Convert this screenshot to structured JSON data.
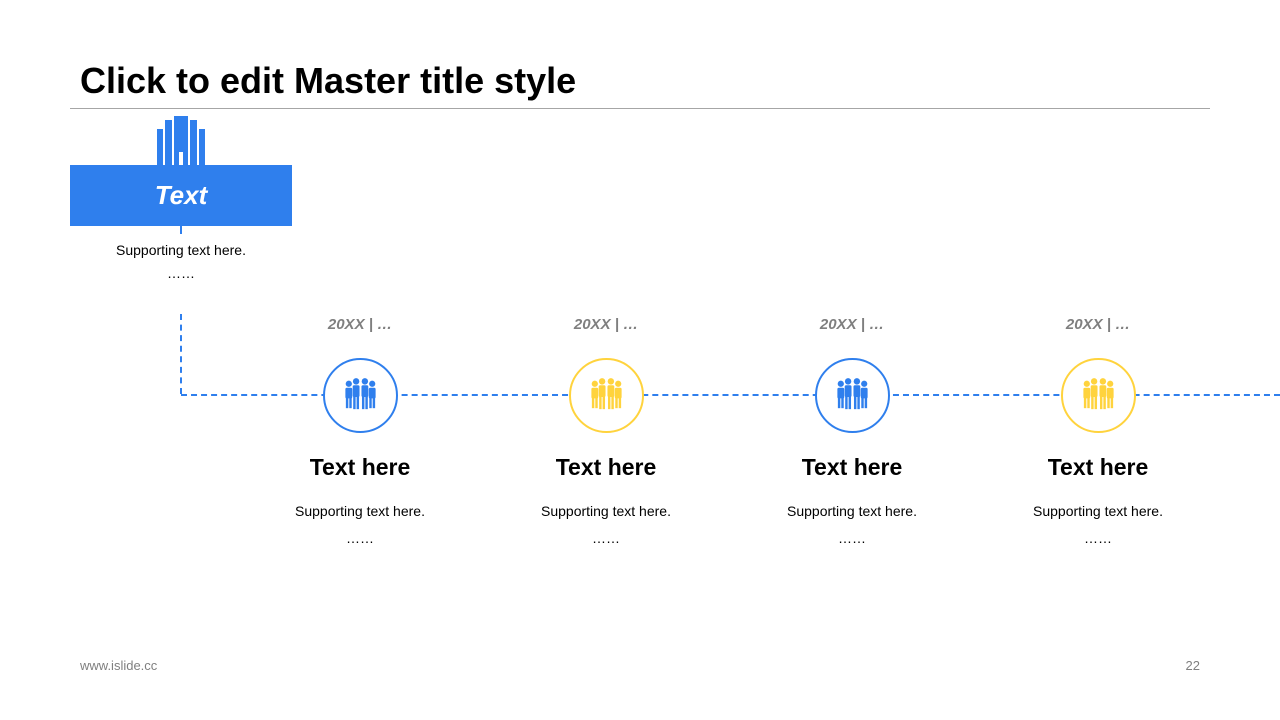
{
  "title": "Click to edit Master title style",
  "intro": {
    "icon": "building-icon",
    "banner_label": "Text",
    "support": "Supporting  text here.",
    "dots": "……"
  },
  "colors": {
    "blue": "#2f7fed",
    "yellow": "#ffd33d",
    "gray": "#7f7f7f"
  },
  "timeline": [
    {
      "date": "20XX | …",
      "icon": "team-icon",
      "color": "blue",
      "heading": "Text here",
      "support": "Supporting  text here.",
      "dots": "……"
    },
    {
      "date": "20XX | …",
      "icon": "team-icon",
      "color": "yellow",
      "heading": "Text here",
      "support": "Supporting  text here.",
      "dots": "……"
    },
    {
      "date": "20XX | …",
      "icon": "team-icon",
      "color": "blue",
      "heading": "Text here",
      "support": "Supporting  text here.",
      "dots": "……"
    },
    {
      "date": "20XX | …",
      "icon": "team-icon",
      "color": "yellow",
      "heading": "Text here",
      "support": "Supporting  text here.",
      "dots": "……"
    }
  ],
  "footer": {
    "url": "www.islide.cc",
    "page": "22"
  }
}
